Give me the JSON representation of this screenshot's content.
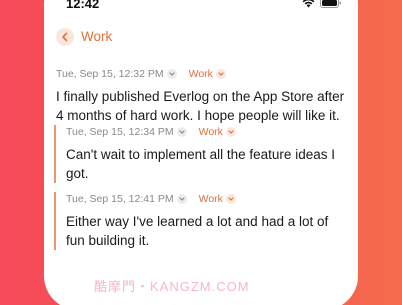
{
  "status": {
    "time": "12:42"
  },
  "header": {
    "title": "Work"
  },
  "entry": {
    "timestamp": "Tue, Sep 15, 12:32 PM",
    "tag": "Work",
    "text": "I finally published Everlog on the App Store after 4 months of hard work. I hope people will like it."
  },
  "replies": [
    {
      "timestamp": "Tue, Sep 15, 12:34 PM",
      "tag": "Work",
      "text": "Can't wait to implement all the feature ideas I got."
    },
    {
      "timestamp": "Tue, Sep 15, 12:41 PM",
      "tag": "Work",
      "text": "Either way I've learned a lot and had a lot of fun building it."
    }
  ],
  "watermark": "酷摩門・KANGZM.COM",
  "colors": {
    "accent": "#e0703e",
    "background_start": "#f7495a",
    "background_end": "#f56a4d"
  }
}
